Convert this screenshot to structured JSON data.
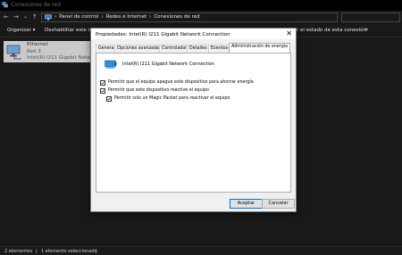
{
  "window": {
    "title": "Conexiones de red"
  },
  "nav": {
    "back": "←",
    "forward": "→",
    "recent": "⌄",
    "up": "↑",
    "breadcrumbs": [
      "›",
      "Panel de control",
      "›",
      "Redes e Internet",
      "›",
      "Conexiones de red"
    ]
  },
  "commands": {
    "organize": "Organizar ▾",
    "disable": "Deshabilitar este d",
    "view_status": "r el estado de esta conexión",
    "more": "»"
  },
  "item": {
    "name": "Ethernet",
    "network": "Red 3",
    "adapter": "Intel(R) I211 Gigabit Network"
  },
  "status": {
    "count": "2 elementos",
    "separator": "|",
    "selected": "1 elemento seleccionado",
    "separator2": "|"
  },
  "dialog": {
    "title": "Propiedades: Intel(R) I211 Gigabit Network Connection",
    "close": "✕",
    "tabs": [
      "General",
      "Opciones avanzadas",
      "Controlador",
      "Detalles",
      "Eventos",
      "Administración de energía"
    ],
    "active_tab": "Administración de energía",
    "adapter_name": "Intel(R) I211 Gigabit Network Connection",
    "options": [
      {
        "label": "Permitir que el equipo apague este dispositivo para ahorrar energía",
        "checked": true
      },
      {
        "label": "Permitir que este dispositivo reactive el equipo",
        "checked": true
      },
      {
        "label": "Permitir solo un Magic Packet para reactivar el equipo",
        "checked": true
      }
    ],
    "ok": "Aceptar",
    "cancel": "Cancelar"
  }
}
